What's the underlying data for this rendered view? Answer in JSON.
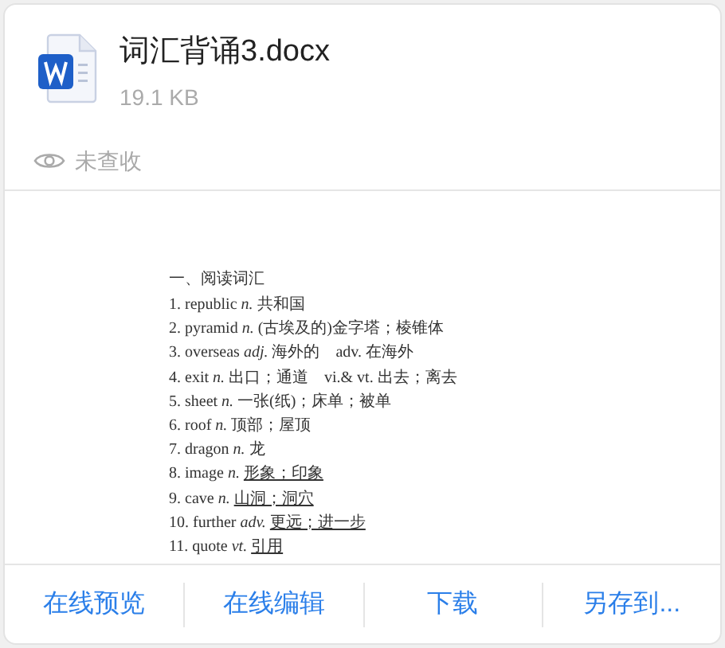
{
  "file": {
    "name": "词汇背诵3.docx",
    "size": "19.1 KB"
  },
  "view_status": "未查收",
  "document": {
    "heading": "一、阅读词汇",
    "items": [
      {
        "num": "1.",
        "word": "republic",
        "pos": "n.",
        "meaning": "共和国",
        "underlined": false
      },
      {
        "num": "2.",
        "word": "pyramid",
        "pos": "n.",
        "meaning": "(古埃及的)金字塔；棱锥体",
        "underlined": false
      },
      {
        "num": "3.",
        "word": "overseas",
        "pos": "adj.",
        "meaning": "海外的　adv. 在海外",
        "underlined": false
      },
      {
        "num": "4.",
        "word": "exit",
        "pos": "n.",
        "meaning": "出口；通道　vi.& vt. 出去；离去",
        "underlined": false
      },
      {
        "num": "5.",
        "word": "sheet",
        "pos": "n.",
        "meaning": "一张(纸)；床单；被单",
        "underlined": false
      },
      {
        "num": "6.",
        "word": "roof",
        "pos": "n.",
        "meaning": "顶部；屋顶",
        "underlined": false
      },
      {
        "num": "7.",
        "word": "dragon",
        "pos": "n.",
        "meaning": "龙",
        "underlined": false
      },
      {
        "num": "8.",
        "word": "image",
        "pos": "n.",
        "meaning": "形象；印象",
        "underlined": true
      },
      {
        "num": "9.",
        "word": "cave",
        "pos": "n.",
        "meaning": "山洞；洞穴",
        "underlined": true
      },
      {
        "num": "10.",
        "word": "further",
        "pos": "adv.",
        "meaning": "更远；进一步",
        "underlined": true
      },
      {
        "num": "11.",
        "word": "quote",
        "pos": "vt.",
        "meaning": "引用",
        "underlined": true
      }
    ]
  },
  "actions": [
    "在线预览",
    "在线编辑",
    "下载",
    "另存到..."
  ]
}
